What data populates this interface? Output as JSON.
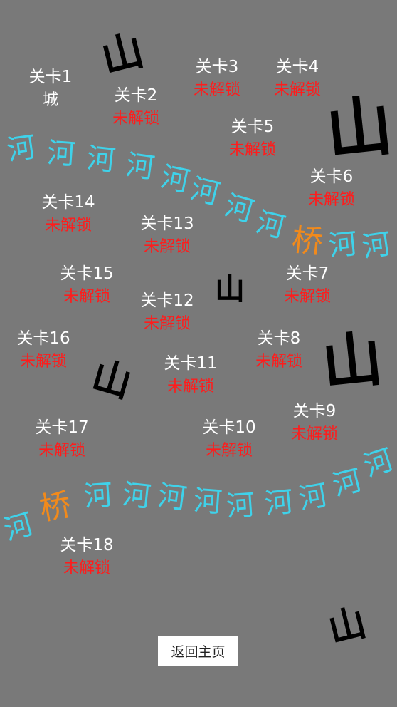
{
  "terrain": {
    "mountain_char": "山",
    "river_char": "河",
    "bridge_char": "桥",
    "colors": {
      "background": "#797979",
      "river": "#3fd2ea",
      "bridge": "#f18a1c",
      "mountain": "#000000",
      "locked": "#ff1c1c",
      "text": "#ffffff"
    }
  },
  "levels": [
    {
      "name": "关卡1",
      "status": "城",
      "locked": false
    },
    {
      "name": "关卡2",
      "status": "未解锁",
      "locked": true
    },
    {
      "name": "关卡3",
      "status": "未解锁",
      "locked": true
    },
    {
      "name": "关卡4",
      "status": "未解锁",
      "locked": true
    },
    {
      "name": "关卡5",
      "status": "未解锁",
      "locked": true
    },
    {
      "name": "关卡6",
      "status": "未解锁",
      "locked": true
    },
    {
      "name": "关卡7",
      "status": "未解锁",
      "locked": true
    },
    {
      "name": "关卡8",
      "status": "未解锁",
      "locked": true
    },
    {
      "name": "关卡9",
      "status": "未解锁",
      "locked": true
    },
    {
      "name": "关卡10",
      "status": "未解锁",
      "locked": true
    },
    {
      "name": "关卡11",
      "status": "未解锁",
      "locked": true
    },
    {
      "name": "关卡12",
      "status": "未解锁",
      "locked": true
    },
    {
      "name": "关卡13",
      "status": "未解锁",
      "locked": true
    },
    {
      "name": "关卡14",
      "status": "未解锁",
      "locked": true
    },
    {
      "name": "关卡15",
      "status": "未解锁",
      "locked": true
    },
    {
      "name": "关卡16",
      "status": "未解锁",
      "locked": true
    },
    {
      "name": "关卡17",
      "status": "未解锁",
      "locked": true
    },
    {
      "name": "关卡18",
      "status": "未解锁",
      "locked": true
    }
  ],
  "back_button_label": "返回主页"
}
